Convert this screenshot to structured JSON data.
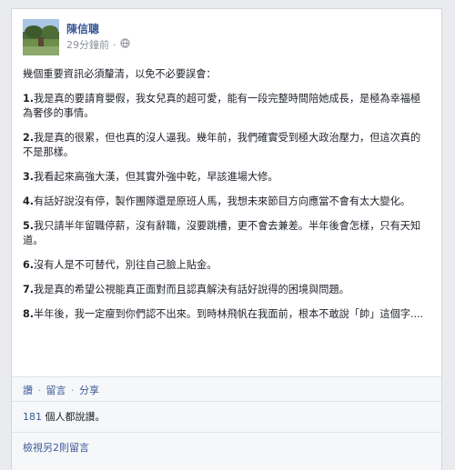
{
  "post": {
    "author": "陳信聰",
    "timestamp": "29分鐘前",
    "privacy_icon": "globe-icon",
    "intro": "幾個重要資訊必須釐清，以免不必要誤會：",
    "items": [
      {
        "num": "1.",
        "text": "我是真的要請育嬰假，我女兒真的超可愛，能有一段完整時間陪她成長，是極為幸福極為奢侈的事情。"
      },
      {
        "num": "2.",
        "text": "我是真的很累，但也真的沒人逼我。幾年前，我們確實受到極大政治壓力，但這次真的不是那樣。"
      },
      {
        "num": "3.",
        "text": "我看起來高強大漢，但其實外強中乾，早該進場大修。"
      },
      {
        "num": "4.",
        "text": "有話好說沒有停，製作團隊還是原班人馬，我想未來節目方向應當不會有太大變化。"
      },
      {
        "num": "5.",
        "text": "我只請半年留職停薪，沒有辭職，沒要跳槽，更不會去兼差。半年後會怎樣，只有天知道。"
      },
      {
        "num": "6.",
        "text": "沒有人是不可替代，別往自己臉上貼金。"
      },
      {
        "num": "7.",
        "text": "我是真的希望公視能真正面對而且認真解決有話好說得的困境與問題。"
      },
      {
        "num": "8.",
        "text": "半年後，我一定瘦到你們認不出來。到時林飛帆在我面前，根本不敢說「帥」這個字...."
      }
    ]
  },
  "actions": {
    "like": "讚",
    "comment": "留言",
    "share": "分享",
    "sep": "·"
  },
  "likes": {
    "count": "181",
    "text": " 個人都說讚。"
  },
  "comments": {
    "view_more": "檢視另2則留言"
  },
  "colors": {
    "link": "#3b5998",
    "meta": "#90949c",
    "footer_bg": "#f6f7f9"
  }
}
